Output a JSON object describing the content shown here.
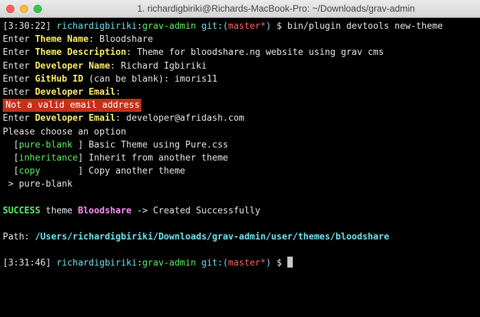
{
  "window": {
    "title": "1. richardigbiriki@Richards-MacBook-Pro: ~/Downloads/grav-admin"
  },
  "prompt1": {
    "time": "[3:30:22]",
    "user": "richardigbiriki",
    "colon": ":",
    "dir": "grav-admin",
    "git_label": "git:(",
    "branch": "master*",
    "git_close": ")",
    "symbol": " $ ",
    "command": "bin/plugin devtools new-theme"
  },
  "lines": {
    "theme_name": {
      "prefix": "Enter ",
      "label": "Theme Name",
      "suffix": ": ",
      "value": "Bloodshare"
    },
    "theme_desc": {
      "prefix": "Enter ",
      "label": "Theme Description",
      "suffix": ": ",
      "value": "Theme for bloodshare.ng website using grav cms"
    },
    "dev_name": {
      "prefix": "Enter ",
      "label": "Developer Name",
      "suffix": ": ",
      "value": "Richard Igbiriki"
    },
    "github": {
      "prefix": "Enter ",
      "label": "GitHub ID",
      "suffix": " (can be blank): ",
      "value": "imoris11"
    },
    "dev_email_1": {
      "prefix": "Enter ",
      "label": "Developer Email",
      "suffix": ":"
    },
    "error": "Not a valid email address",
    "dev_email_2": {
      "prefix": "Enter ",
      "label": "Developer Email",
      "suffix": ": ",
      "value": "developer@afridash.com"
    },
    "choose": "Please choose an option",
    "options": [
      {
        "key": "pure-blank ",
        "desc": "Basic Theme using Pure.css"
      },
      {
        "key": "inheritance",
        "desc": "Inherit from another theme"
      },
      {
        "key": "copy       ",
        "desc": "Copy another theme"
      }
    ],
    "selected": " > pure-blank",
    "success": {
      "word": "SUCCESS",
      "mid": " theme ",
      "name": "Bloodshare",
      "rest": " -> Created Successfully"
    },
    "path": {
      "label": "Path: ",
      "value": "/Users/richardigbiriki/Downloads/grav-admin/user/themes/bloodshare"
    }
  },
  "prompt2": {
    "time": "[3:31:46]",
    "user": "richardigbiriki",
    "colon": ":",
    "dir": "grav-admin",
    "git_label": "git:(",
    "branch": "master*",
    "git_close": ")",
    "symbol": " $ "
  },
  "colors": {
    "background": "#000000",
    "yellow": "#fcee6c",
    "cyan": "#6fe3f0",
    "green": "#5ff067",
    "red": "#ff6464",
    "magenta": "#ff8cf8",
    "error_bg": "#c63017"
  }
}
